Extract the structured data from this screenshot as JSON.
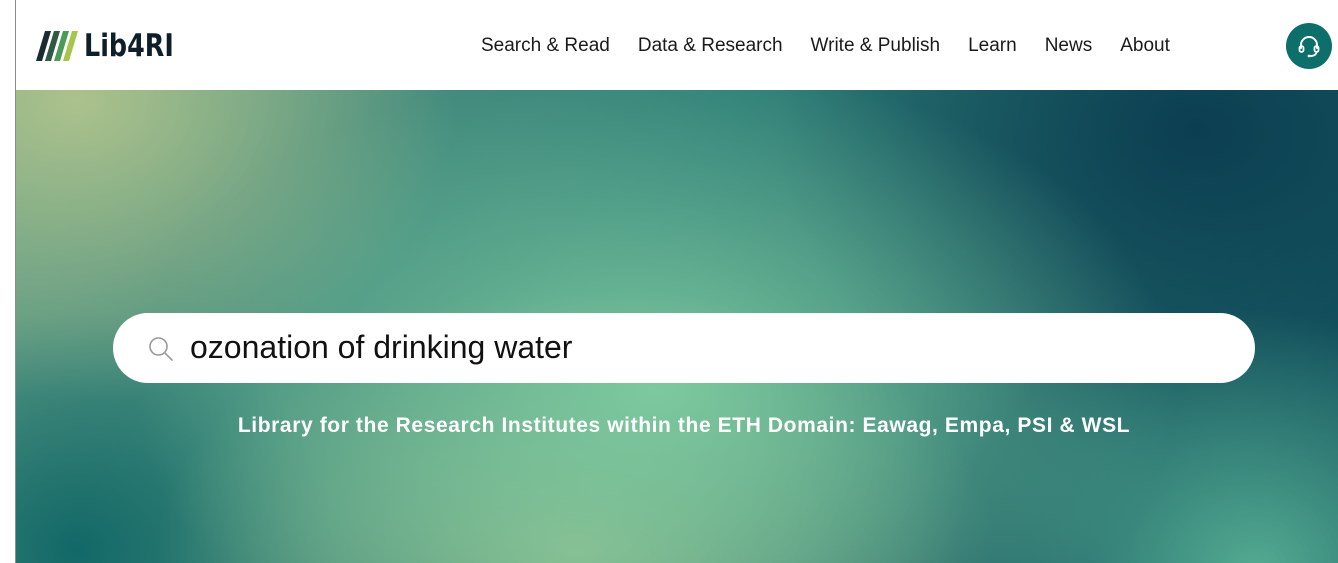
{
  "brand": {
    "name": "Lib4RI",
    "logo_icon": "lib4ri-stripes-logo",
    "logo_colors": [
      "#1a2b34",
      "#3f8a57",
      "#a6c54a"
    ]
  },
  "nav": {
    "items": [
      {
        "label": "Search & Read"
      },
      {
        "label": "Data & Research"
      },
      {
        "label": "Write & Publish"
      },
      {
        "label": "Learn"
      },
      {
        "label": "News"
      },
      {
        "label": "About"
      }
    ]
  },
  "help": {
    "icon": "headset-icon",
    "color": "#0d6f6a"
  },
  "search": {
    "icon": "search-icon",
    "value": "ozonation of drinking water"
  },
  "hero": {
    "tagline": "Library for the Research Institutes within the ETH Domain: Eawag, Empa, PSI & WSL"
  }
}
